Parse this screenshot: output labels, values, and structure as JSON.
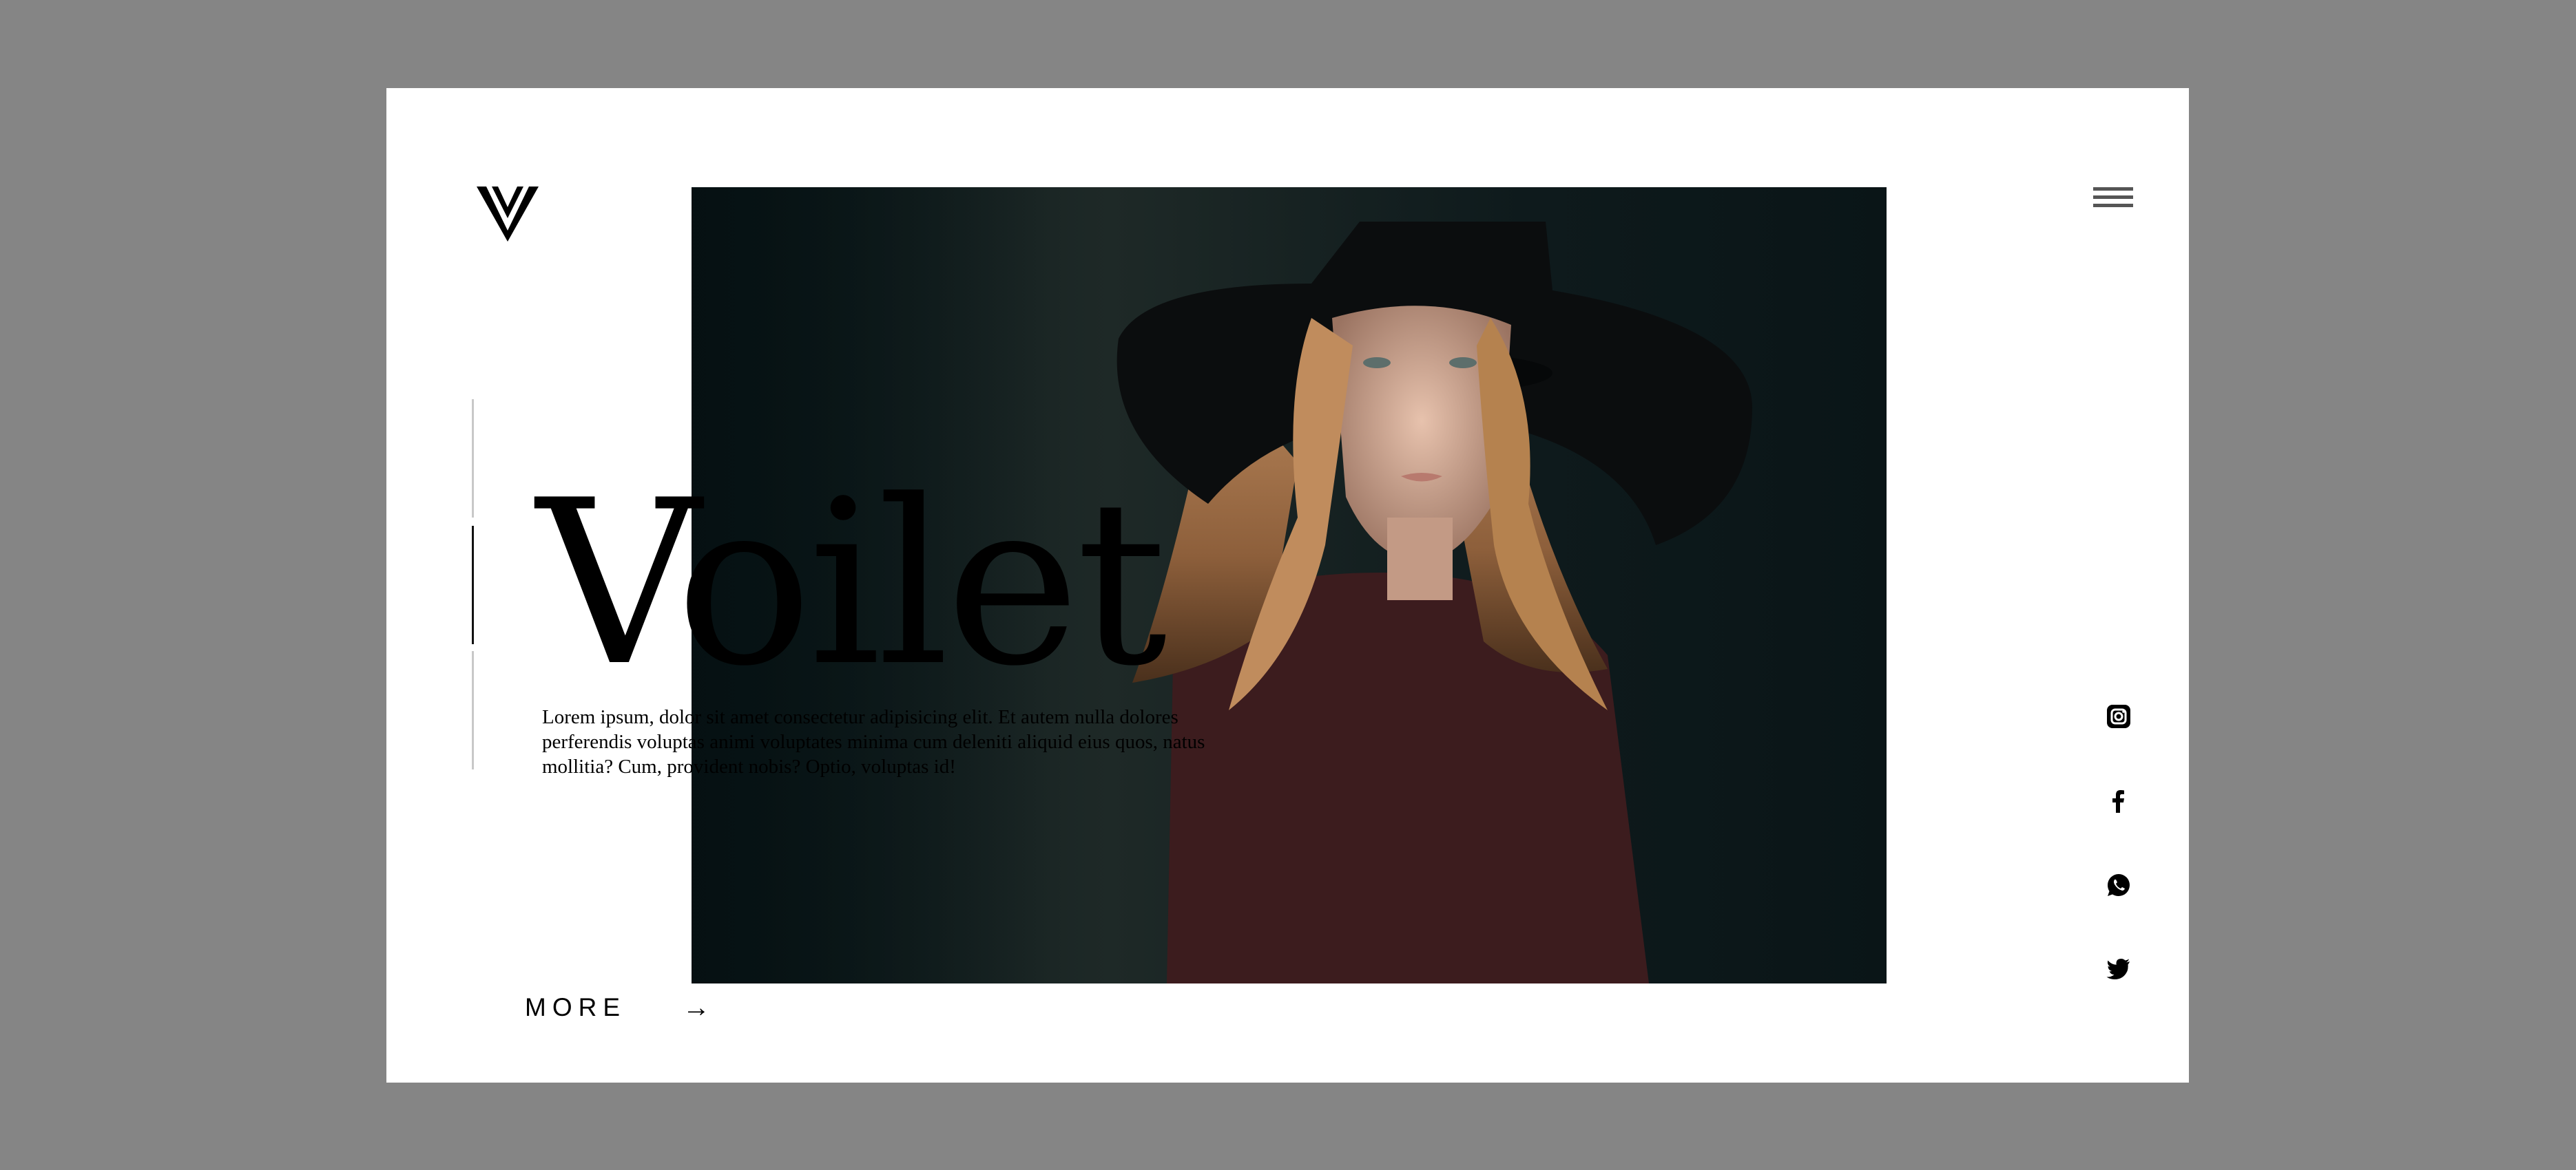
{
  "brand": {
    "name": "Voilet",
    "logo_icon": "v-logo-icon"
  },
  "nav": {
    "menu_icon": "hamburger-menu-icon"
  },
  "hero": {
    "intro": "Lorem ipsum, dolor sit amet consectetur adipisicing elit. Et autem nulla dolores perferendis voluptas animi voluptates minima cum deleniti aliquid eius quos, natus mollitia? Cum, provident nobis? Optio, voluptas id!",
    "more_label": "MORE",
    "more_arrow": "→",
    "image_icon": "portrait-photo"
  },
  "social": [
    {
      "name": "instagram",
      "icon": "instagram-icon"
    },
    {
      "name": "facebook",
      "icon": "facebook-icon"
    },
    {
      "name": "whatsapp",
      "icon": "whatsapp-icon"
    },
    {
      "name": "twitter",
      "icon": "twitter-icon"
    }
  ],
  "colors": {
    "backdrop": "#858585",
    "card": "#ffffff",
    "text": "#000000",
    "photo_bg": "#0f1d1f"
  }
}
